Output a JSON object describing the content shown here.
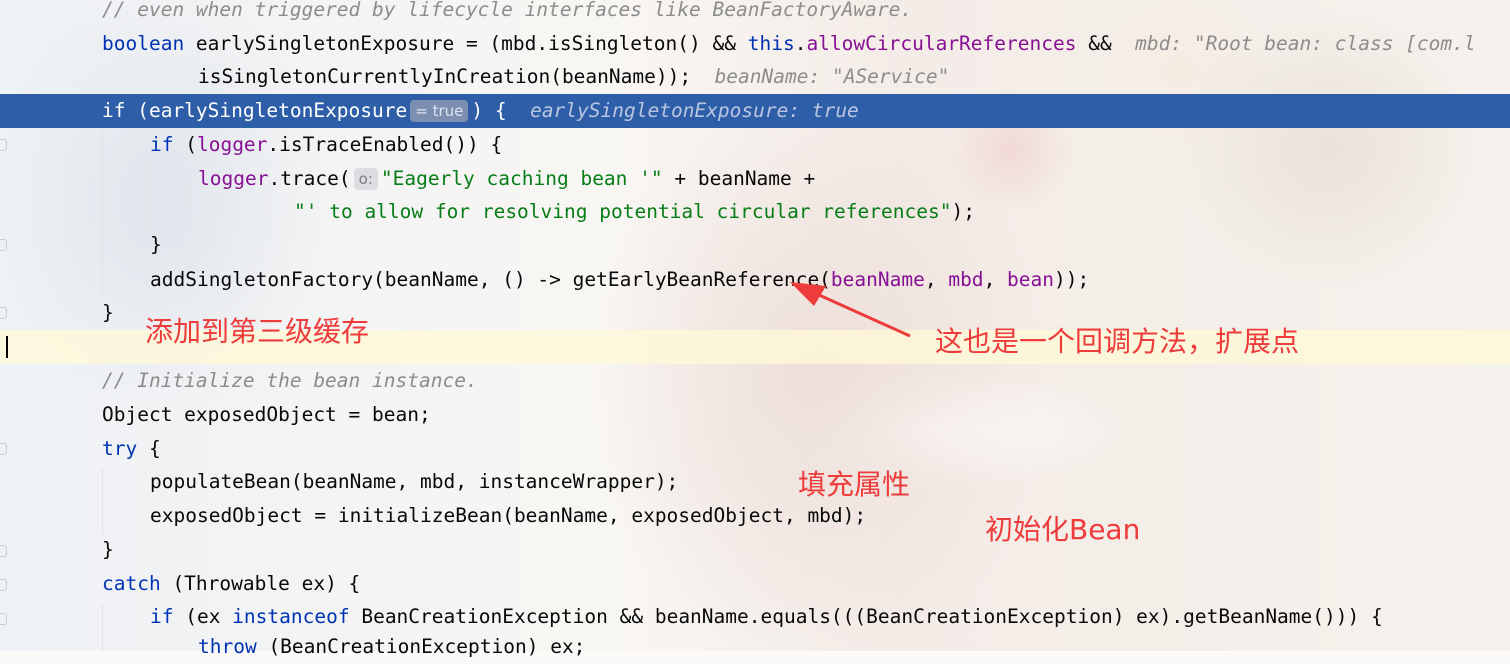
{
  "editor": {
    "lines": [
      {
        "code": "// even when triggered by lifecycle interfaces like BeanFactoryAware."
      },
      {
        "kw1": "boolean",
        "t1": " earlySingletonExposure = (mbd.isSingleton() && ",
        "kw2": "this",
        "t2": ".",
        "fld": "allowCircularReferences",
        "t3": " &&  ",
        "hint": "mbd: \"Root bean: class [com.l"
      },
      {
        "t1": "isSingletonCurrentlyInCreation(beanName));  ",
        "hint": "beanName: \"AService\""
      },
      {
        "kw1": "if",
        "t1": " (earlySingletonExposure",
        "inlay": "= true",
        "t2": ") {  ",
        "hint": "earlySingletonExposure: true"
      },
      {
        "kw1": "if",
        "t1": " (",
        "fld": "logger",
        "t2": ".isTraceEnabled()) {"
      },
      {
        "fld": "logger",
        "t1": ".trace(",
        "inlay": "o:",
        "str": "\"Eagerly caching bean '\"",
        "t2": " + beanName +"
      },
      {
        "str": "\"' to allow for resolving potential circular references\"",
        "t1": ");"
      },
      {
        "t1": "}"
      },
      {
        "t1": "addSingletonFactory(beanName, () -> getEarlyBeanReference(",
        "fld1": "beanName",
        "t2": ", ",
        "fld2": "mbd",
        "t3": ", ",
        "fld3": "bean",
        "t4": "));"
      },
      {
        "t1": "}"
      },
      {
        "t1": ""
      },
      {
        "code": "// Initialize the bean instance."
      },
      {
        "t1": "Object exposedObject = bean;"
      },
      {
        "kw1": "try",
        "t1": " {"
      },
      {
        "t1": "populateBean(beanName, mbd, instanceWrapper);"
      },
      {
        "t1": "exposedObject = initializeBean(beanName, exposedObject, mbd);"
      },
      {
        "t1": "}"
      },
      {
        "kw1": "catch",
        "t1": " (Throwable ex) {"
      },
      {
        "kw1": "if",
        "t1": " (ex ",
        "kw2": "instanceof",
        "t2": " BeanCreationException && beanName.equals(((BeanCreationException) ex).getBeanName())) {"
      },
      {
        "kw1": "throw",
        "t1": " (BeanCreationException) ex;"
      }
    ]
  },
  "annotations": {
    "third_level_cache": "添加到第三级缓存",
    "callback_extension": "这也是一个回调方法，扩展点",
    "populate_properties": "填充属性",
    "initialize_bean": "初始化Bean"
  },
  "colors": {
    "keyword": "#0033b3",
    "field": "#871094",
    "string": "#067d17",
    "comment": "#8c8c8c",
    "selection": "#2f5ea8",
    "annotation": "#ee3b3b"
  },
  "icons": [
    "breakpoint-gutter-icon",
    "fold-marker-icon",
    "red-arrow-icon"
  ]
}
